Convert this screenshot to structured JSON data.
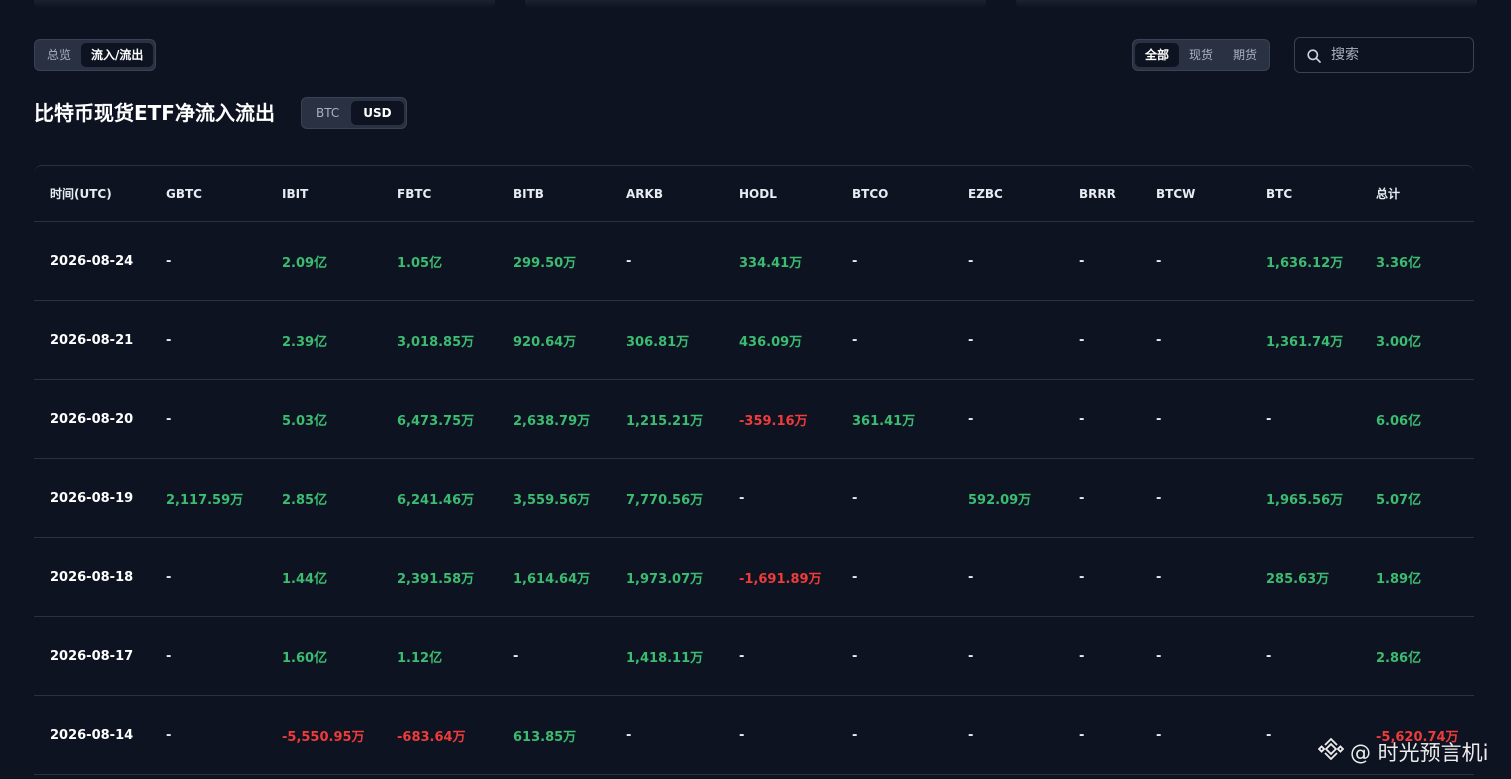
{
  "view_tabs": [
    {
      "label": "总览",
      "active": false
    },
    {
      "label": "流入/流出",
      "active": true
    }
  ],
  "filter_tabs": [
    {
      "label": "全部",
      "active": true
    },
    {
      "label": "现货",
      "active": false
    },
    {
      "label": "期货",
      "active": false
    }
  ],
  "search": {
    "placeholder": "搜索"
  },
  "page_title": "比特币现货ETF净流入流出",
  "unit_tabs": [
    {
      "label": "BTC",
      "active": false
    },
    {
      "label": "USD",
      "active": true
    }
  ],
  "table": {
    "columns": [
      "时间(UTC)",
      "GBTC",
      "IBIT",
      "FBTC",
      "BITB",
      "ARKB",
      "HODL",
      "BTCO",
      "EZBC",
      "BRRR",
      "BTCW",
      "BTC",
      "总计"
    ],
    "rows": [
      [
        "2026-08-24",
        "-",
        "2.09亿",
        "1.05亿",
        "299.50万",
        "-",
        "334.41万",
        "-",
        "-",
        "-",
        "-",
        "1,636.12万",
        "3.36亿"
      ],
      [
        "2026-08-21",
        "-",
        "2.39亿",
        "3,018.85万",
        "920.64万",
        "306.81万",
        "436.09万",
        "-",
        "-",
        "-",
        "-",
        "1,361.74万",
        "3.00亿"
      ],
      [
        "2026-08-20",
        "-",
        "5.03亿",
        "6,473.75万",
        "2,638.79万",
        "1,215.21万",
        "-359.16万",
        "361.41万",
        "-",
        "-",
        "-",
        "-",
        "6.06亿"
      ],
      [
        "2026-08-19",
        "2,117.59万",
        "2.85亿",
        "6,241.46万",
        "3,559.56万",
        "7,770.56万",
        "-",
        "-",
        "592.09万",
        "-",
        "-",
        "1,965.56万",
        "5.07亿"
      ],
      [
        "2026-08-18",
        "-",
        "1.44亿",
        "2,391.58万",
        "1,614.64万",
        "1,973.07万",
        "-1,691.89万",
        "-",
        "-",
        "-",
        "-",
        "285.63万",
        "1.89亿"
      ],
      [
        "2026-08-17",
        "-",
        "1.60亿",
        "1.12亿",
        "-",
        "1,418.11万",
        "-",
        "-",
        "-",
        "-",
        "-",
        "-",
        "2.86亿"
      ],
      [
        "2026-08-14",
        "-",
        "-5,550.95万",
        "-683.64万",
        "613.85万",
        "-",
        "-",
        "-",
        "-",
        "-",
        "-",
        "-",
        "-5,620.74万"
      ]
    ]
  },
  "colors": {
    "positive": "#3cbc71",
    "negative": "#f03b3b",
    "background": "#0d1320"
  },
  "watermark": {
    "text": "@ 时光预言机i",
    "icon": "binance-logo-icon"
  }
}
